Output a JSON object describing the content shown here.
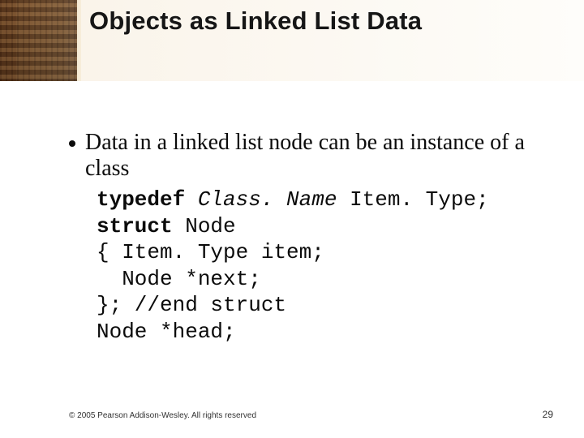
{
  "title": "Objects as Linked List Data",
  "bullet": "Data in a linked list node can be an instance of a class",
  "code": {
    "kw_typedef": "typedef",
    "classname_italic": "Class. Name",
    "l1_rest": " Item. Type;",
    "kw_struct": "struct",
    "l2_rest": " Node",
    "l3": "{ Item. Type item;",
    "l4": "  Node *next;",
    "l5": "}; //end struct",
    "l6": "Node *head;"
  },
  "footer": {
    "copyright": "© 2005 Pearson Addison-Wesley. All rights reserved",
    "page": "29"
  }
}
